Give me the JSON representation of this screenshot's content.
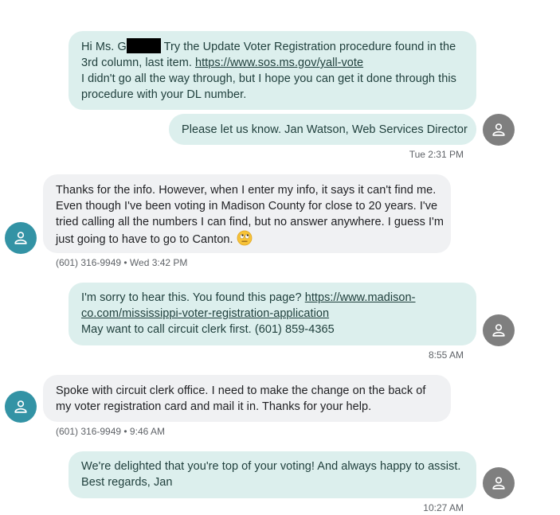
{
  "messages": [
    {
      "lines_prefix": "Hi Ms. G",
      "line1_rest": " Try the Update Voter Registration procedure found in the",
      "line2_text": "3rd column, last item.  ",
      "line2_link": "https://www.sos.ms.gov/yall-vote",
      "line3": "I didn't go all the way through, but I hope you can get it done through this",
      "line4": "procedure with your DL number."
    },
    {
      "text": "Please let us know.  Jan Watson, Web Services Director",
      "timestamp": "Tue 2:31 PM"
    },
    {
      "line1": "Thanks for the info. However, when I enter my info, it says it can't find me.",
      "line2": "Even though I've been voting in Madison County for close to 20 years. I've",
      "line3": "tried calling all the numbers I can find, but no answer anywhere. I guess I'm",
      "line4": "just going to have to go to Canton.",
      "meta": "(601) 316-9949 • Wed 3:42 PM",
      "emoji": "eye-roll-emoji"
    },
    {
      "line1_text": "I'm sorry to hear this.  You found this page? ",
      "line1_link": "https://www.madison-",
      "line2_link": "co.com/mississippi-voter-registration-application",
      "line3": "May want to call circuit clerk first.  (601) 859-4365",
      "timestamp": "8:55 AM"
    },
    {
      "line1": "Spoke with circuit clerk office. I need to make the change on the back of",
      "line2": "my voter registration card and mail it in. Thanks for your help.",
      "meta": "(601) 316-9949 • 9:46 AM"
    },
    {
      "line1": "We're delighted that you're top of your voting!  And always happy to assist.",
      "line2": "Best regards, Jan",
      "timestamp": "10:27 AM"
    }
  ],
  "avatars": {
    "sender_icon": "person-icon",
    "sender_color": "#7f7f7f",
    "contact_color": "#3393a5"
  }
}
